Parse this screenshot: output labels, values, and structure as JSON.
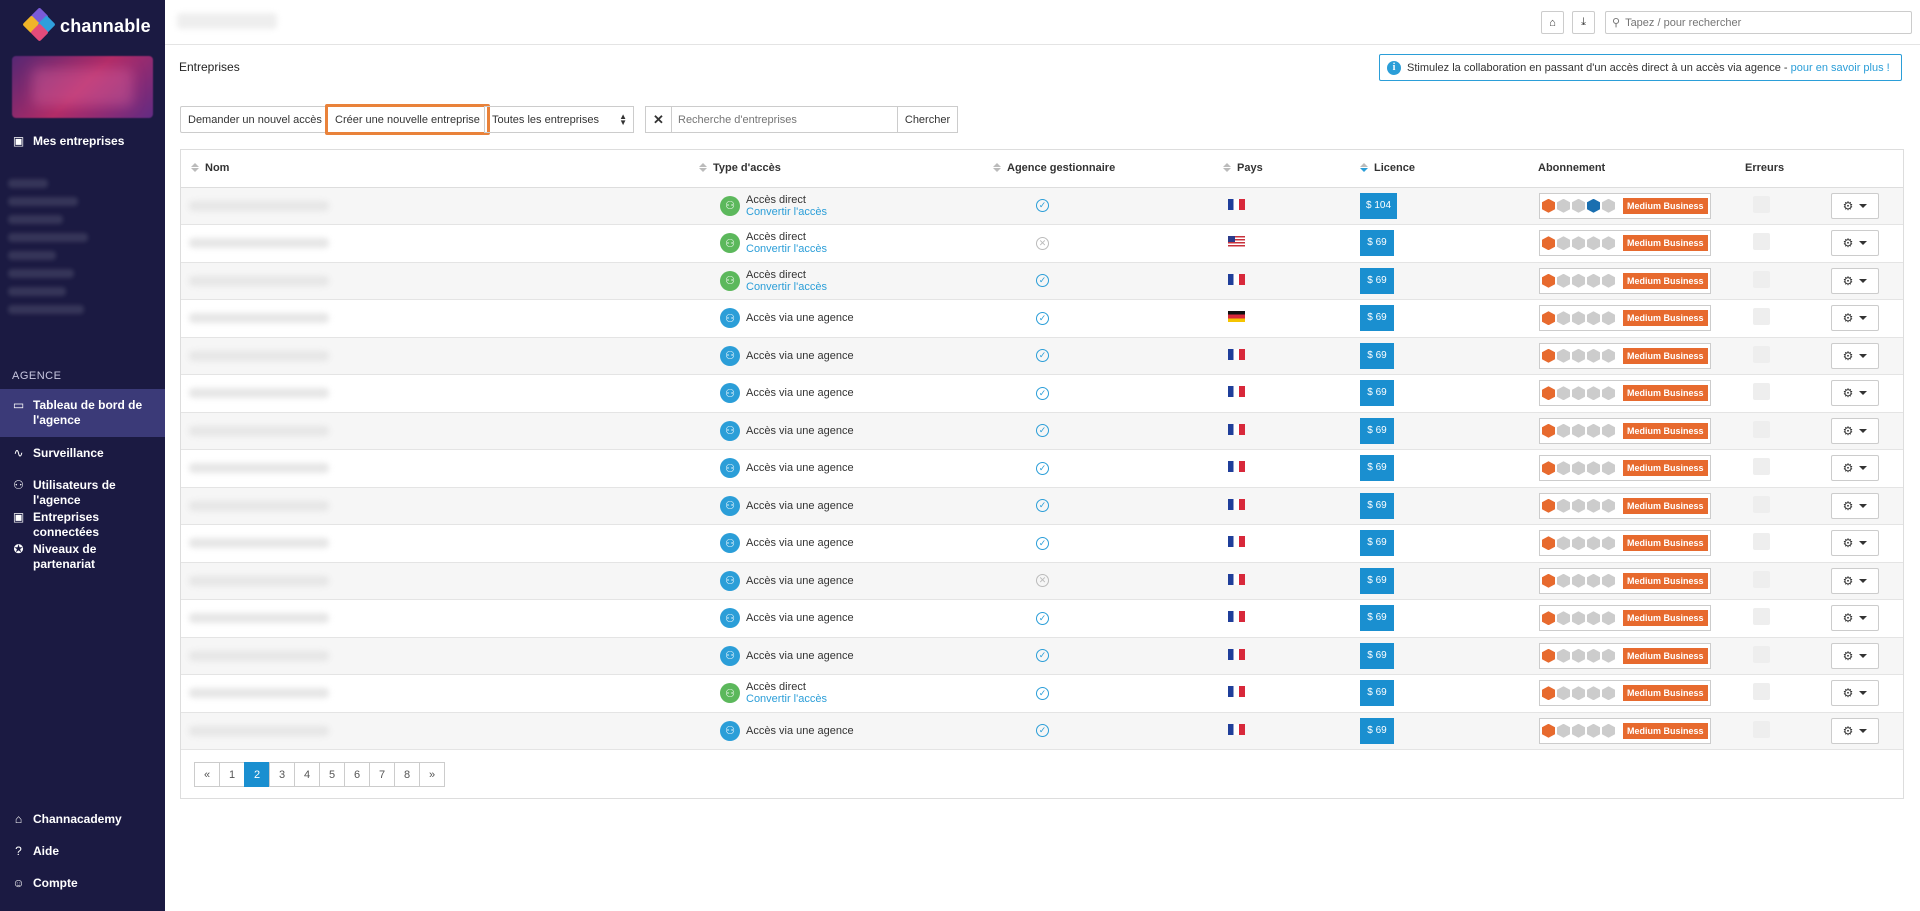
{
  "app": {
    "brand": "channable"
  },
  "sidebar": {
    "my_companies": "Mes entreprises",
    "section_label": "AGENCE",
    "agency_items": [
      {
        "label": "Tableau de bord de l'agence",
        "icon": "monitor-icon",
        "active": true
      },
      {
        "label": "Surveillance",
        "icon": "pulse-icon"
      },
      {
        "label": "Utilisateurs de l'agence",
        "icon": "users-icon"
      },
      {
        "label": "Entreprises connectées",
        "icon": "briefcase-icon"
      },
      {
        "label": "Niveaux de partenariat",
        "icon": "award-icon"
      }
    ],
    "footer_items": [
      {
        "label": "Channacademy",
        "icon": "graduation-cap-icon"
      },
      {
        "label": "Aide",
        "icon": "help-circle-icon"
      },
      {
        "label": "Compte",
        "icon": "user-icon"
      }
    ]
  },
  "topbar": {
    "search_placeholder": "Tapez / pour rechercher"
  },
  "page": {
    "title": "Entreprises",
    "info_text": "Stimulez la collaboration en passant d'un accès direct à un accès via agence - ",
    "info_link": "pour en savoir plus !"
  },
  "toolbar": {
    "request_access": "Demander un nouvel accès",
    "create_company": "Créer une nouvelle entreprise",
    "filter_selected": "Toutes les entreprises",
    "clear": "✕",
    "search_placeholder": "Recherche d'entreprises",
    "search_button": "Chercher"
  },
  "table": {
    "headers": {
      "name": "Nom",
      "access_type": "Type d'accès",
      "managing_agency": "Agence gestionnaire",
      "country": "Pays",
      "licence": "Licence",
      "subscription": "Abonnement",
      "errors": "Erreurs"
    },
    "direct_label": "Accès direct",
    "convert_label": "Convertir l'accès",
    "agency_label": "Accès via une agence",
    "plan_badge": "Medium Business",
    "rows": [
      {
        "access": "direct",
        "managed": true,
        "country": "fr",
        "licence": "$ 104",
        "blue_hex": true
      },
      {
        "access": "direct",
        "managed": false,
        "country": "us",
        "licence": "$ 69"
      },
      {
        "access": "direct",
        "managed": true,
        "country": "fr",
        "licence": "$ 69"
      },
      {
        "access": "agency",
        "managed": true,
        "country": "de",
        "licence": "$ 69"
      },
      {
        "access": "agency",
        "managed": true,
        "country": "fr",
        "licence": "$ 69"
      },
      {
        "access": "agency",
        "managed": true,
        "country": "fr",
        "licence": "$ 69"
      },
      {
        "access": "agency",
        "managed": true,
        "country": "fr",
        "licence": "$ 69"
      },
      {
        "access": "agency",
        "managed": true,
        "country": "fr",
        "licence": "$ 69"
      },
      {
        "access": "agency",
        "managed": true,
        "country": "fr",
        "licence": "$ 69"
      },
      {
        "access": "agency",
        "managed": true,
        "country": "fr",
        "licence": "$ 69"
      },
      {
        "access": "agency",
        "managed": false,
        "country": "fr",
        "licence": "$ 69"
      },
      {
        "access": "agency",
        "managed": true,
        "country": "fr",
        "licence": "$ 69"
      },
      {
        "access": "agency",
        "managed": true,
        "country": "fr",
        "licence": "$ 69"
      },
      {
        "access": "direct",
        "managed": true,
        "country": "fr",
        "licence": "$ 69"
      },
      {
        "access": "agency",
        "managed": true,
        "country": "fr",
        "licence": "$ 69"
      }
    ]
  },
  "pagination": {
    "pages": [
      "«",
      "1",
      "2",
      "3",
      "4",
      "5",
      "6",
      "7",
      "8",
      "»"
    ],
    "current": "2"
  },
  "colors": {
    "sidebar_bg": "#1b1a42",
    "accent": "#1a8fd0",
    "highlight": "#e9823a",
    "badge": "#e76a2e"
  }
}
